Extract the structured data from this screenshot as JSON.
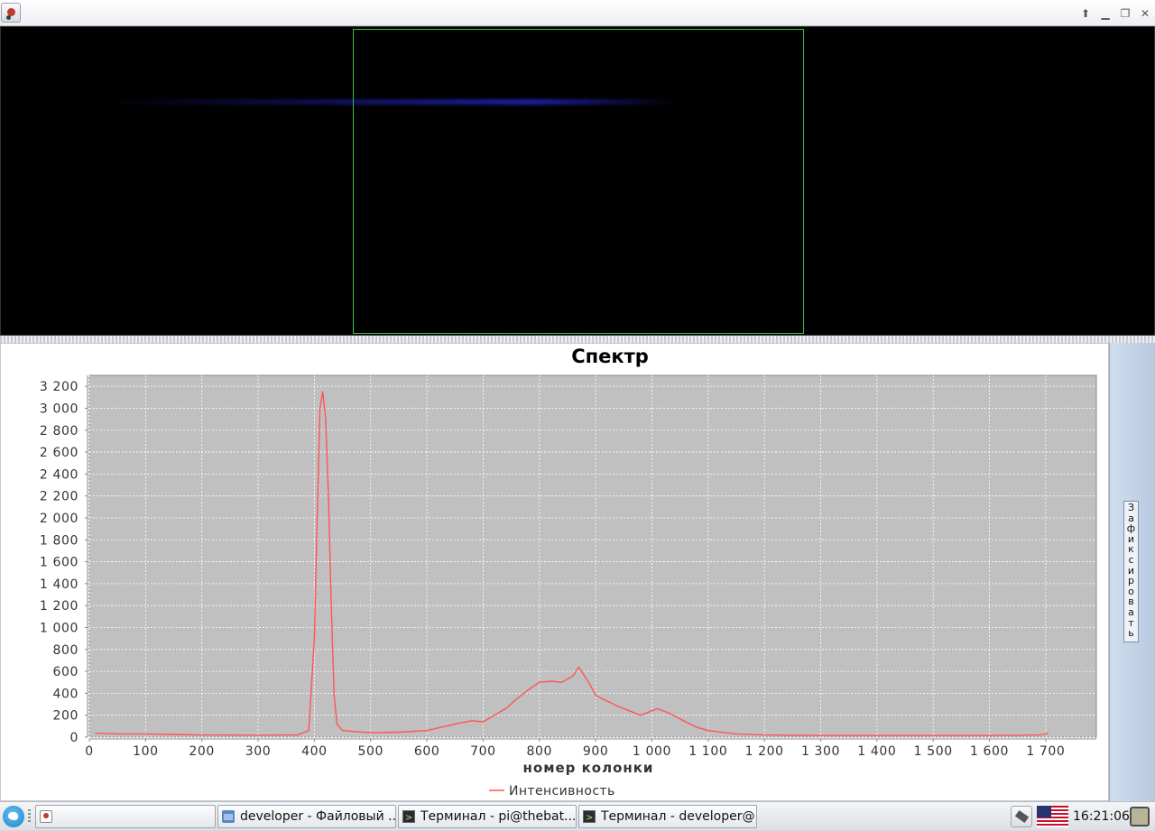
{
  "window": {
    "controls": [
      {
        "name": "window-up-button",
        "glyph": "⬆"
      },
      {
        "name": "window-minimize-button",
        "glyph": "▁"
      },
      {
        "name": "window-restore-button",
        "glyph": "❐"
      },
      {
        "name": "window-close-button",
        "glyph": "✕"
      }
    ]
  },
  "side_panel": {
    "fix_button_label": "Зафиксировать"
  },
  "chart_data": {
    "type": "line",
    "title": "Спектр",
    "xlabel": "номер колонки",
    "ylabel": "",
    "xlim": [
      0,
      1790
    ],
    "ylim": [
      0,
      3300
    ],
    "x_ticks": [
      0,
      100,
      200,
      300,
      400,
      500,
      600,
      700,
      800,
      900,
      1000,
      1100,
      1200,
      1300,
      1400,
      1500,
      1600,
      1700
    ],
    "x_tick_labels": [
      "0",
      "100",
      "200",
      "300",
      "400",
      "500",
      "600",
      "700",
      "800",
      "900",
      "1 000",
      "1 100",
      "1 200",
      "1 300",
      "1 400",
      "1 500",
      "1 600",
      "1 700"
    ],
    "y_ticks": [
      0,
      200,
      400,
      600,
      800,
      1000,
      1200,
      1400,
      1600,
      1800,
      2000,
      2200,
      2400,
      2600,
      2800,
      3000,
      3200
    ],
    "y_tick_labels": [
      "0",
      "200",
      "400",
      "600",
      "800",
      "1 000",
      "1 200",
      "1 400",
      "1 600",
      "1 800",
      "2 000",
      "2 200",
      "2 400",
      "2 600",
      "2 800",
      "3 000",
      "3 200"
    ],
    "grid": true,
    "legend": "bottom",
    "background": "#c0c0c0",
    "series": [
      {
        "name": "Интенсивность",
        "color": "#ff5555",
        "points": [
          [
            10,
            35
          ],
          [
            50,
            30
          ],
          [
            100,
            30
          ],
          [
            150,
            25
          ],
          [
            200,
            20
          ],
          [
            300,
            18
          ],
          [
            370,
            20
          ],
          [
            390,
            60
          ],
          [
            400,
            900
          ],
          [
            405,
            2000
          ],
          [
            410,
            3000
          ],
          [
            415,
            3150
          ],
          [
            420,
            2900
          ],
          [
            425,
            2200
          ],
          [
            430,
            1200
          ],
          [
            435,
            400
          ],
          [
            440,
            120
          ],
          [
            450,
            60
          ],
          [
            500,
            40
          ],
          [
            550,
            45
          ],
          [
            600,
            60
          ],
          [
            650,
            120
          ],
          [
            680,
            150
          ],
          [
            700,
            140
          ],
          [
            720,
            200
          ],
          [
            740,
            260
          ],
          [
            760,
            350
          ],
          [
            780,
            430
          ],
          [
            800,
            500
          ],
          [
            820,
            510
          ],
          [
            840,
            500
          ],
          [
            860,
            560
          ],
          [
            870,
            640
          ],
          [
            880,
            560
          ],
          [
            890,
            480
          ],
          [
            900,
            380
          ],
          [
            920,
            330
          ],
          [
            940,
            280
          ],
          [
            960,
            240
          ],
          [
            980,
            200
          ],
          [
            1000,
            240
          ],
          [
            1010,
            260
          ],
          [
            1030,
            220
          ],
          [
            1060,
            140
          ],
          [
            1080,
            90
          ],
          [
            1100,
            60
          ],
          [
            1150,
            30
          ],
          [
            1200,
            20
          ],
          [
            1300,
            15
          ],
          [
            1400,
            15
          ],
          [
            1500,
            15
          ],
          [
            1600,
            15
          ],
          [
            1690,
            20
          ],
          [
            1700,
            30
          ],
          [
            1705,
            40
          ]
        ]
      }
    ]
  },
  "taskbar": {
    "tasks": [
      {
        "label": "",
        "icon": "java-app-icon"
      },
      {
        "label": "developer - Файловый ...",
        "icon": "folder-icon"
      },
      {
        "label": "Терминал - pi@thebat...",
        "icon": "terminal-icon"
      },
      {
        "label": "Терминал - developer@...",
        "icon": "terminal-icon"
      }
    ],
    "clock": "16:21:06",
    "keyboard_layout": "us-flag-icon"
  }
}
